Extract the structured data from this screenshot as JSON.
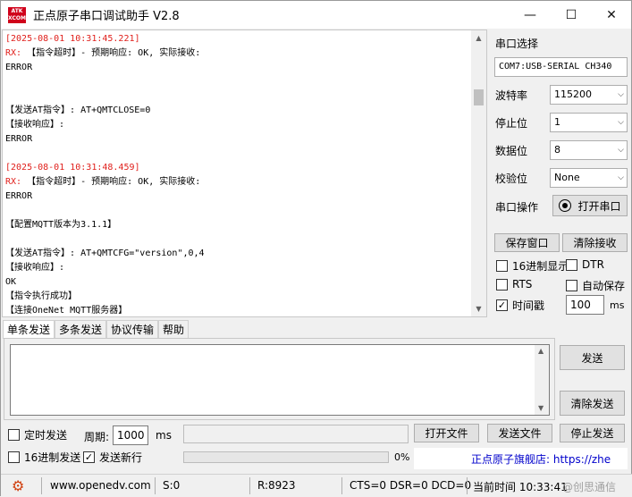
{
  "window": {
    "title": "正点原子串口调试助手 V2.8",
    "logo_line1": "ATK",
    "logo_line2": "XCOM",
    "min": "—",
    "max": "☐",
    "close": "✕"
  },
  "receive": {
    "lines": [
      {
        "cls": "ts",
        "text": "[2025-08-01 10:31:45.221]"
      },
      {
        "cls": "rx",
        "prefix": "RX: ",
        "text": "【指令超时】- 预期响应: OK, 实际接收:"
      },
      {
        "cls": "",
        "text": "ERROR"
      },
      {
        "cls": "",
        "text": ""
      },
      {
        "cls": "",
        "text": ""
      },
      {
        "cls": "",
        "text": "【发送AT指令】: AT+QMTCLOSE=0"
      },
      {
        "cls": "",
        "text": "【接收响应】:"
      },
      {
        "cls": "",
        "text": "ERROR"
      },
      {
        "cls": "",
        "text": ""
      },
      {
        "cls": "ts",
        "text": "[2025-08-01 10:31:48.459]"
      },
      {
        "cls": "rx",
        "prefix": "RX: ",
        "text": "【指令超时】- 预期响应: OK, 实际接收:"
      },
      {
        "cls": "",
        "text": "ERROR"
      },
      {
        "cls": "",
        "text": ""
      },
      {
        "cls": "",
        "text": "【配置MQTT版本为3.1.1】"
      },
      {
        "cls": "",
        "text": ""
      },
      {
        "cls": "",
        "text": "【发送AT指令】: AT+QMTCFG=\"version\",0,4"
      },
      {
        "cls": "",
        "text": "【接收响应】:"
      },
      {
        "cls": "",
        "text": "OK"
      },
      {
        "cls": "",
        "text": "【指令执行成功】"
      },
      {
        "cls": "",
        "text": "【连接OneNet MQTT服务器】"
      }
    ]
  },
  "panel": {
    "port_select_label": "串口选择",
    "port_value": "COM7:USB-SERIAL CH340",
    "baud_label": "波特率",
    "baud_value": "115200",
    "stop_label": "停止位",
    "stop_value": "1",
    "data_label": "数据位",
    "data_value": "8",
    "parity_label": "校验位",
    "parity_value": "None",
    "op_label": "串口操作",
    "open_port": "打开串口",
    "save_window": "保存窗口",
    "clear_recv": "清除接收",
    "hex_display": "16进制显示",
    "dtr": "DTR",
    "rts": "RTS",
    "auto_save": "自动保存",
    "timestamp": "时间戳",
    "timestamp_checked": "✓",
    "timestamp_value": "100",
    "ms": "ms"
  },
  "tabs": [
    "单条发送",
    "多条发送",
    "协议传输",
    "帮助"
  ],
  "send": {
    "send_btn": "发送",
    "clear_send": "清除发送",
    "timed_send": "定时发送",
    "period_label": "周期:",
    "period_value": "1000",
    "ms": "ms",
    "open_file": "打开文件",
    "send_file": "发送文件",
    "stop_send": "停止发送",
    "hex_send": "16进制发送",
    "send_newline": "发送新行",
    "newline_checked": "✓",
    "progress": "0%",
    "ad_text": "正点原子旗舰店: https://zhe"
  },
  "status": {
    "site": "www.openedv.com",
    "s": "S:0",
    "r": "R:8923",
    "lines": "CTS=0 DSR=0 DCD=0",
    "time": "当前时间 10:33:41",
    "watermark": "@创思通信"
  }
}
